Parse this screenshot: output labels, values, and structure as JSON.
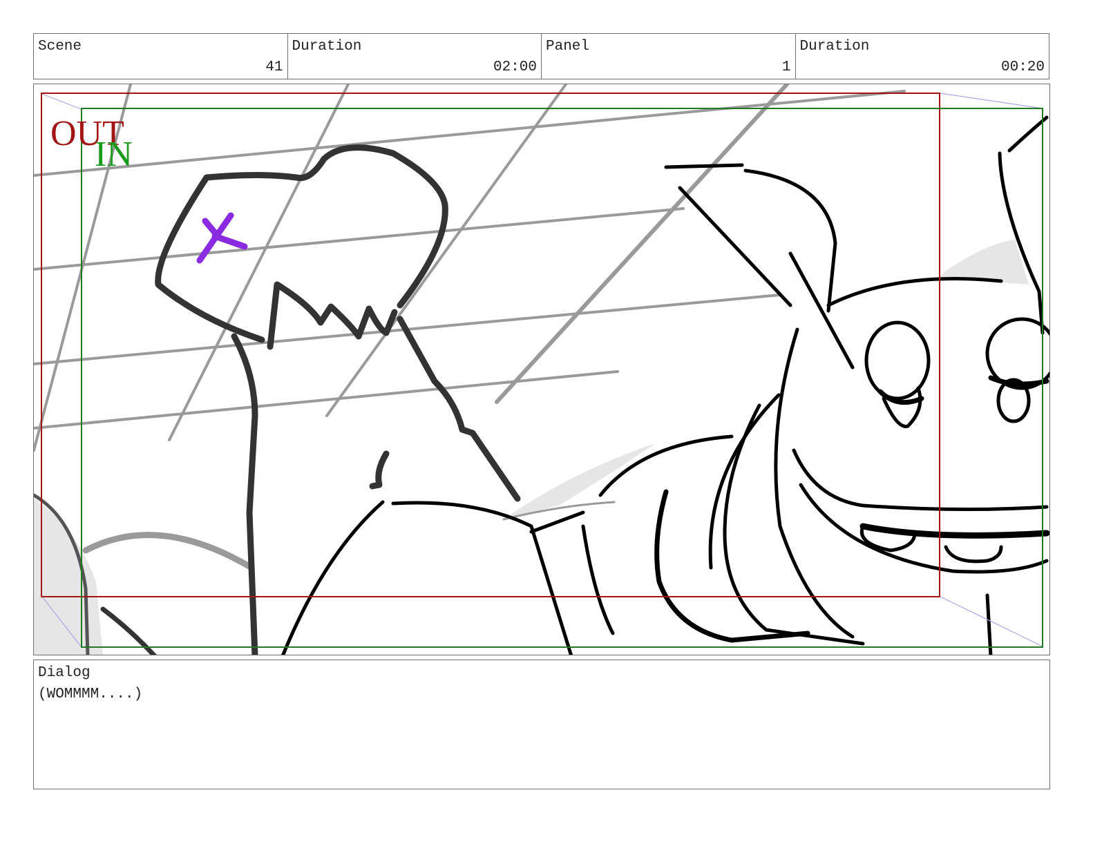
{
  "header": {
    "scene_label": "Scene",
    "scene_value": "41",
    "scene_duration_label": "Duration",
    "scene_duration_value": "02:00",
    "panel_label": "Panel",
    "panel_value": "1",
    "panel_duration_label": "Duration",
    "panel_duration_value": "00:20"
  },
  "frame": {
    "out_label": "OUT",
    "in_label": "IN",
    "colors": {
      "out_frame": "#a31515",
      "in_frame": "#1f7a1f",
      "camera_arrows": "#a9a6e8",
      "mark": "#8a2be2"
    }
  },
  "dialog": {
    "label": "Dialog",
    "text": "(WOMMMM....)"
  }
}
